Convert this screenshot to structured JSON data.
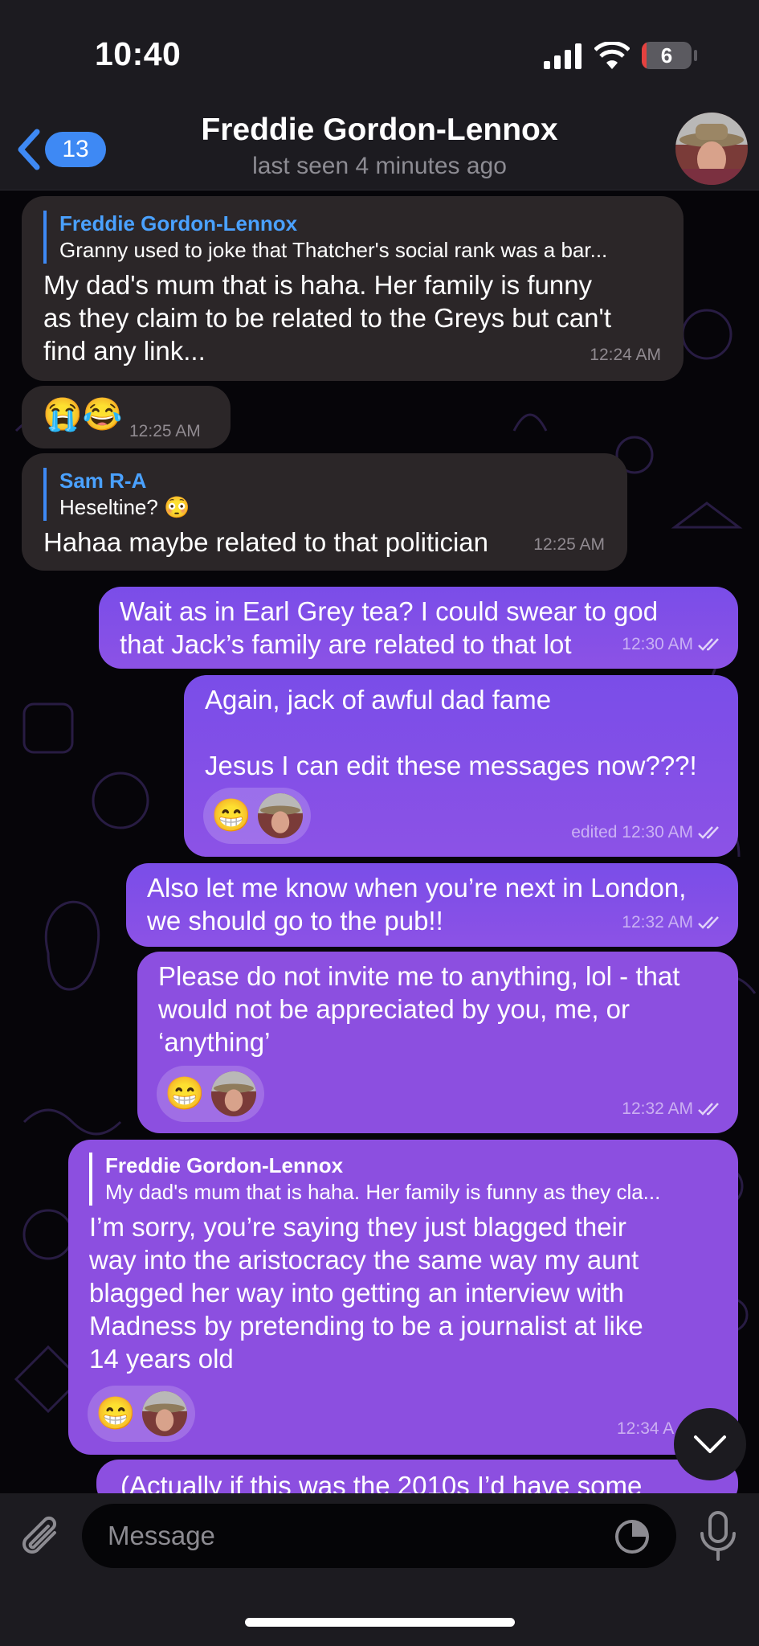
{
  "status": {
    "time": "10:40",
    "battery": "6"
  },
  "header": {
    "back_count": "13",
    "title": "Freddie Gordon-Lennox",
    "subtitle": "last seen 4 minutes ago"
  },
  "messages": [
    {
      "reply_name": "Freddie Gordon-Lennox",
      "reply_text": "Granny used to joke that Thatcher's social rank was a bar...",
      "lines": [
        "My dad's mum that is haha. Her family is funny",
        "as they claim to be related to the Greys but can't",
        "find any link..."
      ],
      "time": "12:24 AM"
    },
    {
      "emoji": "😭😂",
      "time": "12:25 AM"
    },
    {
      "reply_name": "Sam R-A",
      "reply_text": "Heseltine? 😳",
      "lines": [
        "Hahaa maybe related to that politician"
      ],
      "time": "12:25 AM"
    },
    {
      "lines": [
        "Wait as in Earl Grey tea? I could swear to god",
        "that Jack’s family are related to that lot"
      ],
      "time": "12:30 AM"
    },
    {
      "lines": [
        "Again, jack of awful dad fame",
        "",
        "Jesus I can edit these messages now???!"
      ],
      "reaction": "😁",
      "time": "edited 12:30 AM"
    },
    {
      "lines": [
        "Also let me know when you’re next in London,",
        "we should go to the pub!!"
      ],
      "time": "12:32 AM"
    },
    {
      "lines": [
        "Please do not invite me to anything, lol - that",
        "would not be appreciated by you, me, or",
        "‘anything’"
      ],
      "reaction": "😁",
      "time": "12:32 AM"
    },
    {
      "reply_name": "Freddie Gordon-Lennox",
      "reply_text": "My dad's mum that is haha. Her family is funny as they cla...",
      "lines": [
        "I’m sorry, you’re saying they just blagged their",
        "way into the aristocracy the same way my aunt",
        "blagged her way into getting an interview with",
        "Madness by pretending to be a journalist at like",
        "14 years old"
      ],
      "reaction": "😁",
      "time": "12:34 A"
    },
    {
      "lines": [
        "(Actually if this was the 2010s I’d have some"
      ]
    }
  ],
  "composer": {
    "placeholder": "Message"
  }
}
